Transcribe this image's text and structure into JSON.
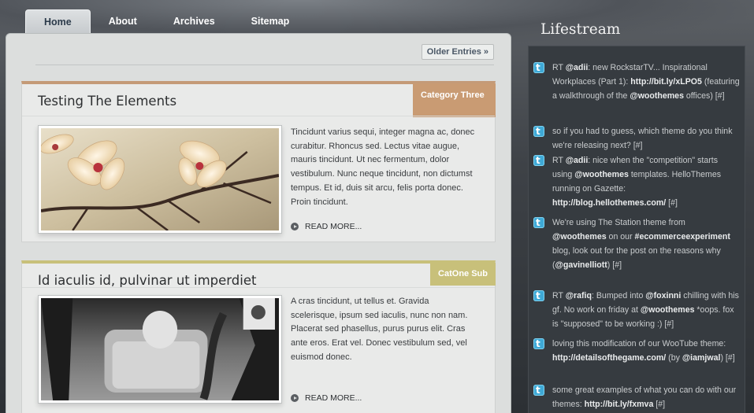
{
  "nav": {
    "tabs": [
      {
        "label": "Home",
        "active": true
      },
      {
        "label": "About",
        "active": false
      },
      {
        "label": "Archives",
        "active": false
      },
      {
        "label": "Sitemap",
        "active": false
      }
    ]
  },
  "main": {
    "older_entries": "Older Entries »",
    "posts": [
      {
        "title": "Testing The Elements",
        "category": "Category Three",
        "category_color": "#c99b73",
        "excerpt": "Tincidunt varius sequi, integer magna ac, donec curabitur. Rhoncus sed. Lectus vitae augue, mauris tincidunt. Ut nec fermentum, dolor vestibulum. Nunc neque tincidunt, non dictumst tempus. Et id, duis sit arcu, felis porta donec. Proin tincidunt.",
        "read_more": "READ MORE...",
        "thumbnail": "magnolia-blossoms-photo"
      },
      {
        "title": "Id iaculis id, pulvinar ut imperdiet",
        "category": "CatOne Sub",
        "category_color": "#c8c07a",
        "excerpt": "A cras tincidunt, ut tellus et. Gravida scelerisque, ipsum sed iaculis, nunc non nam. Placerat sed phasellus, purus purus elit. Cras ante eros. Erat vel. Donec vestibulum sed, vel euismod donec.",
        "read_more": "READ MORE...",
        "thumbnail": "fashion-chair-photo"
      }
    ]
  },
  "sidebar": {
    "title": "Lifestream",
    "items": [
      {
        "html": "RT <b>@adii</b>: new RockstarTV... Inspirational Workplaces (Part 1): <b>http://bit.ly/xLPO5</b> (featuring a walkthrough of the <b>@woothemes</b> offices) [#]"
      },
      {
        "html": "so if you had to guess, which theme do you think we're releasing next? [#]"
      },
      {
        "html": "RT <b>@adii</b>: nice when the \"competition\" starts using <b>@woothemes</b> templates. HelloThemes running on Gazette: <b>http://blog.hellothemes.com/</b> [#]"
      },
      {
        "html": "We're using The Station theme from <b>@woothemes</b> on our <b>#ecommerceexperiment</b> blog, look out for the post on the reasons why (<b>@gavinelliott</b>) [#]"
      },
      {
        "html": "RT <b>@rafiq</b>: Bumped into <b>@foxinni</b> chilling with his gf. No work on friday at <b>@woothemes</b> *oops. fox is \"supposed\" to be working :) [#]"
      },
      {
        "html": "loving this modification of our WooTube theme: <b>http://detailsofthegame.com/</b> (by <b>@iamjwal</b>) [#]"
      },
      {
        "html": "some great examples of what you can do with our themes: <b>http://bit.ly/fxmva</b> [#]"
      }
    ]
  }
}
